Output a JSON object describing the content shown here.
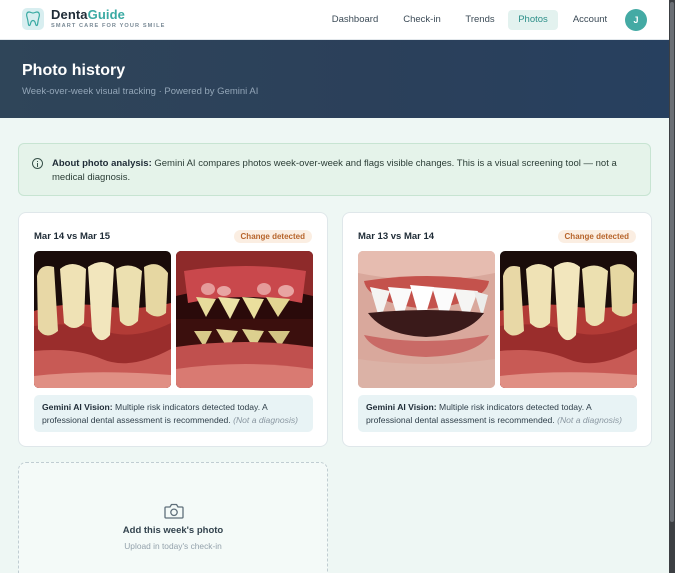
{
  "brand": {
    "name_part1": "Denta",
    "name_part2": "Guide",
    "tagline": "SMART CARE FOR YOUR SMILE"
  },
  "nav": [
    {
      "label": "Dashboard",
      "active": false
    },
    {
      "label": "Check-in",
      "active": false
    },
    {
      "label": "Trends",
      "active": false
    },
    {
      "label": "Photos",
      "active": true
    },
    {
      "label": "Account",
      "active": false
    }
  ],
  "user": {
    "initial": "J"
  },
  "hero": {
    "title": "Photo history",
    "subtitle": "Week-over-week visual tracking · Powered by Gemini AI"
  },
  "info": {
    "icon": "info-icon",
    "title": "About photo analysis:",
    "body": " Gemini AI compares photos week-over-week and flags visible changes. This is a visual screening tool — not a medical diagnosis."
  },
  "comparisons": [
    {
      "range": "Mar 14 vs Mar 15",
      "badge": "Change detected",
      "note_label": "Gemini AI Vision:",
      "note_text": " Multiple risk indicators detected today. A professional dental assessment is recommended. ",
      "note_disclaimer": "(Not a diagnosis)"
    },
    {
      "range": "Mar 13 vs Mar 14",
      "badge": "Change detected",
      "note_label": "Gemini AI Vision:",
      "note_text": " Multiple risk indicators detected today. A professional dental assessment is recommended. ",
      "note_disclaimer": "(Not a diagnosis)"
    }
  ],
  "add_photo": {
    "icon": "camera-icon",
    "title": "Add this week's photo",
    "hint": "Upload in today's check-in"
  },
  "colors": {
    "accent": "#3aaaa3",
    "hero_bg": "#2b405a",
    "badge_text": "#b7652c",
    "badge_bg": "#fbeee2",
    "info_bg": "#e5f3ea"
  }
}
